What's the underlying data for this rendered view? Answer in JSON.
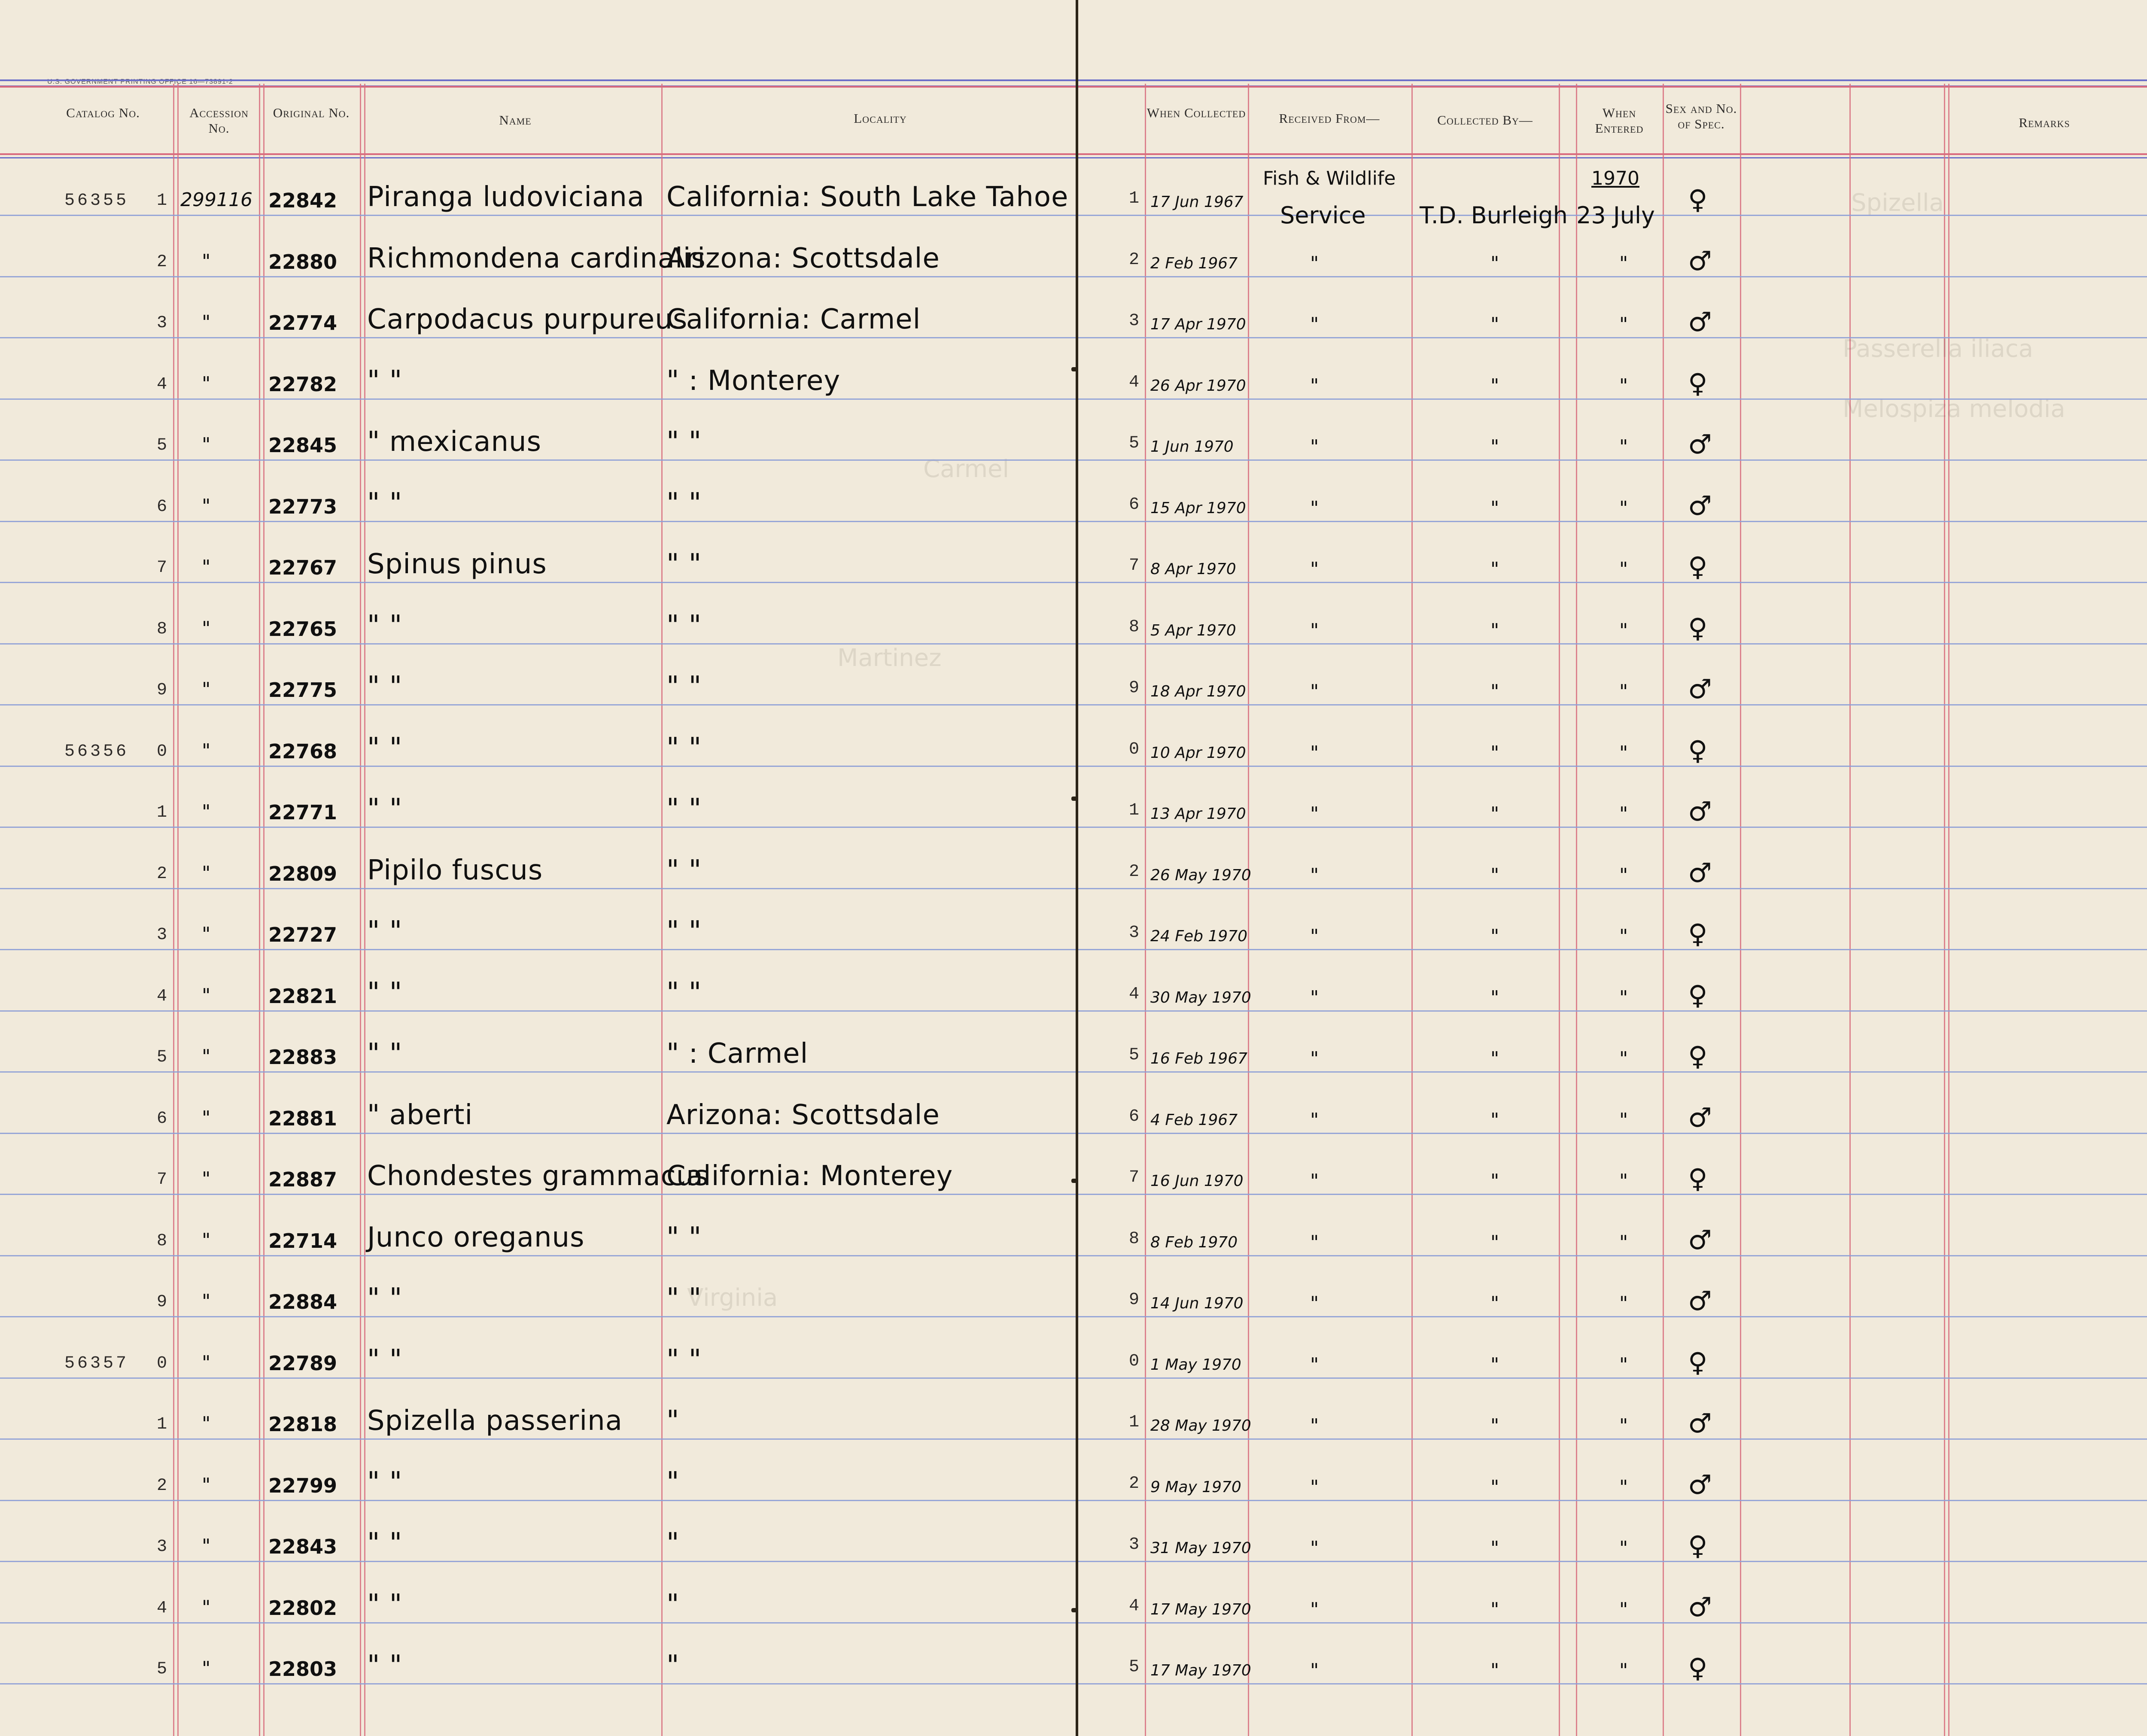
{
  "header": {
    "gpo": "U.S. GOVERNMENT PRINTING OFFICE     16—73891-2",
    "catalog": "Catalog No.",
    "accession": "Accession No.",
    "original": "Original No.",
    "name": "Name",
    "locality": "Locality",
    "when_collected": "When Collected",
    "received_from": "Received From—",
    "collected_by": "Collected By—",
    "when_entered": "When Entered",
    "sex": "Sex and No. of Spec.",
    "remarks": "Remarks"
  },
  "entry_head": {
    "fish": "Fish & Wildlife",
    "year": "1970"
  },
  "rows": [
    {
      "cat_prefix": "56355",
      "cat": "1",
      "acc": "299116",
      "orig": "22842",
      "name": "Piranga ludoviciana",
      "loc": "California: South Lake Tahoe",
      "dnum": "1",
      "date": "17 Jun 1967",
      "recv": "Service",
      "coll": "T.D. Burleigh",
      "entered": "23 July",
      "sex": "♀"
    },
    {
      "cat_prefix": "",
      "cat": "2",
      "acc": "\"",
      "orig": "22880",
      "name": "Richmondena cardinalis",
      "loc": "Arizona: Scottsdale",
      "dnum": "2",
      "date": "2 Feb 1967",
      "recv": "\"",
      "coll": "\"",
      "entered": "\"",
      "sex": "♂"
    },
    {
      "cat_prefix": "",
      "cat": "3",
      "acc": "\"",
      "orig": "22774",
      "name": "Carpodacus purpureus",
      "loc": "California: Carmel",
      "dnum": "3",
      "date": "17 Apr 1970",
      "recv": "\"",
      "coll": "\"",
      "entered": "\"",
      "sex": "♂"
    },
    {
      "cat_prefix": "",
      "cat": "4",
      "acc": "\"",
      "orig": "22782",
      "name": "\"      \"",
      "loc": "\"             : Monterey",
      "dnum": "4",
      "date": "26 Apr 1970",
      "recv": "\"",
      "coll": "\"",
      "entered": "\"",
      "sex": "♀"
    },
    {
      "cat_prefix": "",
      "cat": "5",
      "acc": "\"",
      "orig": "22845",
      "name": "\"      mexicanus",
      "loc": "\"          \"",
      "dnum": "5",
      "date": "1 Jun 1970",
      "recv": "\"",
      "coll": "\"",
      "entered": "\"",
      "sex": "♂"
    },
    {
      "cat_prefix": "",
      "cat": "6",
      "acc": "\"",
      "orig": "22773",
      "name": "\"      \"",
      "loc": "\"          \"",
      "dnum": "6",
      "date": "15 Apr 1970",
      "recv": "\"",
      "coll": "\"",
      "entered": "\"",
      "sex": "♂"
    },
    {
      "cat_prefix": "",
      "cat": "7",
      "acc": "\"",
      "orig": "22767",
      "name": "Spinus   pinus",
      "loc": "\"          \"",
      "dnum": "7",
      "date": "8 Apr 1970",
      "recv": "\"",
      "coll": "\"",
      "entered": "\"",
      "sex": "♀"
    },
    {
      "cat_prefix": "",
      "cat": "8",
      "acc": "\"",
      "orig": "22765",
      "name": "\"      \"",
      "loc": "\"          \"",
      "dnum": "8",
      "date": "5 Apr 1970",
      "recv": "\"",
      "coll": "\"",
      "entered": "\"",
      "sex": "♀"
    },
    {
      "cat_prefix": "",
      "cat": "9",
      "acc": "\"",
      "orig": "22775",
      "name": "\"      \"",
      "loc": "\"          \"",
      "dnum": "9",
      "date": "18 Apr 1970",
      "recv": "\"",
      "coll": "\"",
      "entered": "\"",
      "sex": "♂"
    },
    {
      "cat_prefix": "56356",
      "cat": "0",
      "acc": "\"",
      "orig": "22768",
      "name": "\"      \"",
      "loc": "\"          \"",
      "dnum": "0",
      "date": "10 Apr 1970",
      "recv": "\"",
      "coll": "\"",
      "entered": "\"",
      "sex": "♀"
    },
    {
      "cat_prefix": "",
      "cat": "1",
      "acc": "\"",
      "orig": "22771",
      "name": "\"      \"",
      "loc": "\"          \"",
      "dnum": "1",
      "date": "13 Apr 1970",
      "recv": "\"",
      "coll": "\"",
      "entered": "\"",
      "sex": "♂"
    },
    {
      "cat_prefix": "",
      "cat": "2",
      "acc": "\"",
      "orig": "22809",
      "name": "Pipilo  fuscus",
      "loc": "\"          \"",
      "dnum": "2",
      "date": "26 May 1970",
      "recv": "\"",
      "coll": "\"",
      "entered": "\"",
      "sex": "♂"
    },
    {
      "cat_prefix": "",
      "cat": "3",
      "acc": "\"",
      "orig": "22727",
      "name": "\"      \"",
      "loc": "\"          \"",
      "dnum": "3",
      "date": "24 Feb 1970",
      "recv": "\"",
      "coll": "\"",
      "entered": "\"",
      "sex": "♀"
    },
    {
      "cat_prefix": "",
      "cat": "4",
      "acc": "\"",
      "orig": "22821",
      "name": "\"      \"",
      "loc": "\"          \"",
      "dnum": "4",
      "date": "30 May 1970",
      "recv": "\"",
      "coll": "\"",
      "entered": "\"",
      "sex": "♀"
    },
    {
      "cat_prefix": "",
      "cat": "5",
      "acc": "\"",
      "orig": "22883",
      "name": "\"      \"",
      "loc": "\"        : Carmel",
      "dnum": "5",
      "date": "16 Feb 1967",
      "recv": "\"",
      "coll": "\"",
      "entered": "\"",
      "sex": "♀"
    },
    {
      "cat_prefix": "",
      "cat": "6",
      "acc": "\"",
      "orig": "22881",
      "name": "\"      aberti",
      "loc": "Arizona: Scottsdale",
      "dnum": "6",
      "date": "4 Feb 1967",
      "recv": "\"",
      "coll": "\"",
      "entered": "\"",
      "sex": "♂"
    },
    {
      "cat_prefix": "",
      "cat": "7",
      "acc": "\"",
      "orig": "22887",
      "name": "Chondestes grammacus",
      "loc": "California: Monterey",
      "dnum": "7",
      "date": "16 Jun 1970",
      "recv": "\"",
      "coll": "\"",
      "entered": "\"",
      "sex": "♀"
    },
    {
      "cat_prefix": "",
      "cat": "8",
      "acc": "\"",
      "orig": "22714",
      "name": "Junco  oreganus",
      "loc": "\"          \"",
      "dnum": "8",
      "date": "8 Feb 1970",
      "recv": "\"",
      "coll": "\"",
      "entered": "\"",
      "sex": "♂"
    },
    {
      "cat_prefix": "",
      "cat": "9",
      "acc": "\"",
      "orig": "22884",
      "name": "\"      \"",
      "loc": "\"          \"",
      "dnum": "9",
      "date": "14 Jun 1970",
      "recv": "\"",
      "coll": "\"",
      "entered": "\"",
      "sex": "♂"
    },
    {
      "cat_prefix": "56357",
      "cat": "0",
      "acc": "\"",
      "orig": "22789",
      "name": "\"      \"",
      "loc": "\"          \"",
      "dnum": "0",
      "date": "1 May 1970",
      "recv": "\"",
      "coll": "\"",
      "entered": "\"",
      "sex": "♀"
    },
    {
      "cat_prefix": "",
      "cat": "1",
      "acc": "\"",
      "orig": "22818",
      "name": "Spizella passerina",
      "loc": "\"          ",
      "dnum": "1",
      "date": "28 May 1970",
      "recv": "\"",
      "coll": "\"",
      "entered": "\"",
      "sex": "♂"
    },
    {
      "cat_prefix": "",
      "cat": "2",
      "acc": "\"",
      "orig": "22799",
      "name": "\"      \"",
      "loc": "\"          ",
      "dnum": "2",
      "date": "9 May 1970",
      "recv": "\"",
      "coll": "\"",
      "entered": "\"",
      "sex": "♂"
    },
    {
      "cat_prefix": "",
      "cat": "3",
      "acc": "\"",
      "orig": "22843",
      "name": "\"      \"",
      "loc": "\"          ",
      "dnum": "3",
      "date": "31 May 1970",
      "recv": "\"",
      "coll": "\"",
      "entered": "\"",
      "sex": "♀"
    },
    {
      "cat_prefix": "",
      "cat": "4",
      "acc": "\"",
      "orig": "22802",
      "name": "\"      \"",
      "loc": "\"          ",
      "dnum": "4",
      "date": "17 May 1970",
      "recv": "\"",
      "coll": "\"",
      "entered": "\"",
      "sex": "♂"
    },
    {
      "cat_prefix": "",
      "cat": "5",
      "acc": "\"",
      "orig": "22803",
      "name": "\"      \"",
      "loc": "\"          ",
      "dnum": "5",
      "date": "17 May 1970",
      "recv": "\"",
      "coll": "\"",
      "entered": "\"",
      "sex": "♀"
    }
  ]
}
